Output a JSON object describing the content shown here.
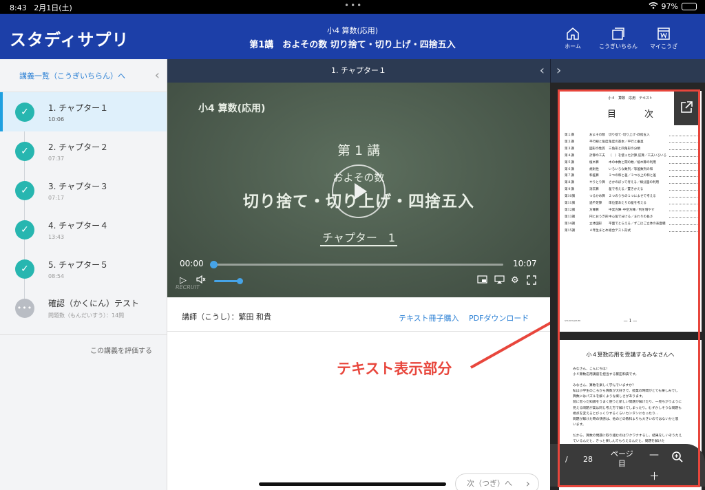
{
  "status": {
    "time": "8:43",
    "date": "2月1日(土)",
    "battery": "97%",
    "battery_level": 0.97
  },
  "header": {
    "logo": "スタディサプリ",
    "subject": "小4 算数(応用)",
    "lecture": "第1講　およその数 切り捨て・切り上げ・四捨五入",
    "nav": [
      {
        "label": "ホーム",
        "icon": "home-icon"
      },
      {
        "label": "こうぎいちらん",
        "icon": "lecture-list-icon"
      },
      {
        "label": "マイこうざ",
        "icon": "my-course-icon"
      }
    ]
  },
  "sidebar": {
    "back_link": "講義一覧（こうぎいちらん）へ",
    "chapters": [
      {
        "title": "1. チャプター１",
        "duration": "10:06",
        "done": true,
        "active": true
      },
      {
        "title": "2. チャプター２",
        "duration": "07:37",
        "done": true,
        "active": false
      },
      {
        "title": "3. チャプター３",
        "duration": "07:17",
        "done": true,
        "active": false
      },
      {
        "title": "4. チャプター４",
        "duration": "13:43",
        "done": true,
        "active": false
      },
      {
        "title": "5. チャプター５",
        "duration": "08:54",
        "done": true,
        "active": false
      }
    ],
    "test": {
      "title": "確認（かくにん）テスト",
      "sub": "問題数（もんだいすう）：14問",
      "badge": "•••"
    },
    "rate": "この講義を評価する"
  },
  "player": {
    "chapter_bar": "1. チャプター１",
    "board": {
      "subject": "小4 算数(応用)",
      "lecture": "第 1 講",
      "topic": "およその数",
      "main": "切り捨て・切り上げ・四捨五入",
      "chapter": "チャプター　1"
    },
    "current": "00:00",
    "total": "10:07",
    "progress": 0.0,
    "volume": 0.6,
    "watermark": "RECRUIT"
  },
  "info": {
    "teacher": "講師（こうし）：繁田 和貴",
    "buy": "テキスト冊子購入",
    "pdf": "PDFダウンロード"
  },
  "annotation": "テキスト表示部分",
  "next": "次（つぎ）へ",
  "textpane": {
    "page1": {
      "head": "小４　算数　応用　テキスト",
      "title": "目　次",
      "toc": [
        {
          "n": "第１講",
          "s": "およその数",
          "t": "切り捨て･切り上げ･四捨五入"
        },
        {
          "n": "第２講",
          "s": "平行線と角度",
          "t": "角度の基本／平行と垂直"
        },
        {
          "n": "第３講",
          "s": "図形の性質",
          "t": "三角形と四角形の分類"
        },
        {
          "n": "第４講",
          "s": "計算の工夫",
          "t": "（　）を使った計算,逆算／工夫いろいろ"
        },
        {
          "n": "第５講",
          "s": "植木算",
          "t": "木の本数と間の数／植木算の利用"
        },
        {
          "n": "第６講",
          "s": "規則性",
          "t": "いろいろな数列／等差数列の和"
        },
        {
          "n": "第７講",
          "s": "和差算",
          "t": "２つの和と差／３つ以上の和と差"
        },
        {
          "n": "第８講",
          "s": "やりとり算",
          "t": "さかのぼって考える／線分図の利用"
        },
        {
          "n": "第９講",
          "s": "消去算",
          "t": "差で考える／置きかえる"
        },
        {
          "n": "第10講",
          "s": "つるかめ算",
          "t": "２つのうちの１つによせて考える"
        },
        {
          "n": "第11講",
          "s": "過不足算",
          "t": "単位量あたりの差を考える"
        },
        {
          "n": "第12講",
          "s": "方陣算",
          "t": "中実方陣･中空方陣／列を増やす"
        },
        {
          "n": "第13講",
          "s": "円とおうぎ形",
          "t": "中心角で分ける／まわりの長さ"
        },
        {
          "n": "第14講",
          "s": "立体図形",
          "t": "平面でとらえる／ずこほご立体の表面積"
        },
        {
          "n": "第15講",
          "s": "４年生まとめ",
          "t": "総合テスト形式"
        }
      ],
      "page_number": "— 1 —",
      "footer": "STUDYSAPURI"
    },
    "page2": {
      "title": "小４算数応用を受講するみなさんへ",
      "body": [
        "みなさん、こんにちは！",
        "小４算数応用講座を担当する繁田和貴です。",
        "",
        "みなさん、算数を楽しく学んでいますか？",
        "私は小学生のころから算数が大好きで、授業の時間がとても楽しみでし",
        "算数にはパズルを解くような楽しさがあります。",
        "前に習った知識をうまく使うと新しい問題が解けたり、一見ちがうように",
        "見える問題が実は同じ考え方で解けてしまったり。むずかしそうな問題も",
        "視点を変えるとびっくりするくらいカンタンになったり…",
        "問題が解けた時の快感は、他のどの教科よりも大きいのではないかと思",
        "います。",
        "",
        "だから、算数の問題に取り組むのはワクワクするし、結果をしいぞうたえ",
        "ているんだと、きっと楽しんでもらえるんだと、問題を解けた"
      ]
    },
    "page_current": "/",
    "page_total": "28",
    "page_list_label": "ページ\n目"
  }
}
